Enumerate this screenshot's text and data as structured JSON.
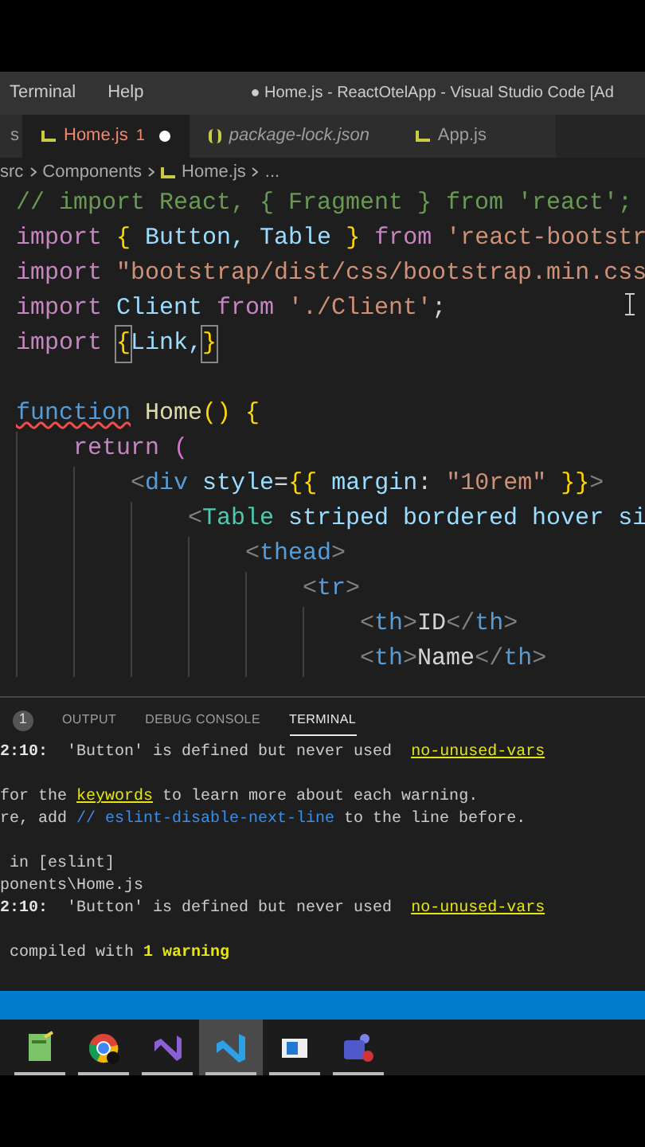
{
  "menu_bar": {
    "items": [
      "Terminal",
      "Help"
    ],
    "title": "● Home.js - ReactOtelApp - Visual Studio Code [Ad"
  },
  "tabs": [
    {
      "label": "s",
      "kind": "cut",
      "selected": false
    },
    {
      "label": "Home.js",
      "kind": "js",
      "problems": "1",
      "modified": true,
      "selected": true
    },
    {
      "label": "package-lock.json",
      "kind": "json",
      "preview": true,
      "selected": false
    },
    {
      "label": "App.js",
      "kind": "js",
      "selected": false
    }
  ],
  "breadcrumb": [
    {
      "label": "src",
      "kind": "folder"
    },
    {
      "label": "Components",
      "kind": "folder"
    },
    {
      "label": "Home.js",
      "kind": "js"
    },
    {
      "label": "...",
      "kind": "symbol"
    }
  ],
  "code": {
    "lines": [
      [
        {
          "text": "// import React, { Fragment } from 'react';",
          "kind": "comment"
        }
      ],
      [
        {
          "text": "import",
          "kind": "keyword"
        },
        {
          "text": " {",
          "kind": "brace"
        },
        {
          "text": " Button, Table ",
          "kind": "variable"
        },
        {
          "text": "}",
          "kind": "brace"
        },
        {
          "text": " from",
          "kind": "keyword"
        },
        {
          "text": " 'react-bootstr",
          "kind": "string"
        }
      ],
      [
        {
          "text": "import",
          "kind": "keyword"
        },
        {
          "text": " \"bootstrap/dist/css/bootstrap.min.css",
          "kind": "string"
        }
      ],
      [
        {
          "text": "import",
          "kind": "keyword"
        },
        {
          "text": " Client",
          "kind": "variable"
        },
        {
          "text": " from",
          "kind": "keyword"
        },
        {
          "text": " './Client'",
          "kind": "string"
        },
        {
          "text": ";",
          "kind": "plain"
        }
      ],
      [
        {
          "text": "import ",
          "kind": "keyword"
        },
        {
          "text": "{",
          "kind": "matched-brace"
        },
        {
          "text": "Link,",
          "kind": "variable"
        },
        {
          "text": "}",
          "kind": "matched-brace"
        }
      ],
      [
        {
          "kind": "blank"
        }
      ],
      [
        {
          "text": "function",
          "kind": "error-keyword"
        },
        {
          "text": " Home",
          "kind": "function"
        },
        {
          "text": "() {",
          "kind": "brace"
        }
      ],
      [
        {
          "text": "    return",
          "kind": "keyword"
        },
        {
          "text": " (",
          "kind": "paren"
        }
      ],
      [
        {
          "text": "        <",
          "kind": "punct"
        },
        {
          "text": "div",
          "kind": "tag"
        },
        {
          "text": " style",
          "kind": "variable"
        },
        {
          "text": "=",
          "kind": "plain"
        },
        {
          "text": "{{",
          "kind": "brace"
        },
        {
          "text": " margin",
          "kind": "variable"
        },
        {
          "text": ": ",
          "kind": "plain"
        },
        {
          "text": "\"10rem\"",
          "kind": "string"
        },
        {
          "text": " }}",
          "kind": "brace"
        },
        {
          "text": ">",
          "kind": "punct"
        }
      ],
      [
        {
          "text": "            <",
          "kind": "punct"
        },
        {
          "text": "Table",
          "kind": "component"
        },
        {
          "text": " striped bordered hover si",
          "kind": "variable"
        }
      ],
      [
        {
          "text": "                <",
          "kind": "punct"
        },
        {
          "text": "thead",
          "kind": "tag"
        },
        {
          "text": ">",
          "kind": "punct"
        }
      ],
      [
        {
          "text": "                    <",
          "kind": "punct"
        },
        {
          "text": "tr",
          "kind": "tag"
        },
        {
          "text": ">",
          "kind": "punct"
        }
      ],
      [
        {
          "text": "                        <",
          "kind": "punct"
        },
        {
          "text": "th",
          "kind": "tag"
        },
        {
          "text": ">",
          "kind": "punct"
        },
        {
          "text": "ID",
          "kind": "plain"
        },
        {
          "text": "</",
          "kind": "punct"
        },
        {
          "text": "th",
          "kind": "tag"
        },
        {
          "text": ">",
          "kind": "punct"
        }
      ],
      [
        {
          "text": "                        <",
          "kind": "punct"
        },
        {
          "text": "th",
          "kind": "tag"
        },
        {
          "text": ">",
          "kind": "punct"
        },
        {
          "text": "Name",
          "kind": "plain"
        },
        {
          "text": "</",
          "kind": "punct"
        },
        {
          "text": "th",
          "kind": "tag"
        },
        {
          "text": ">",
          "kind": "punct"
        }
      ]
    ]
  },
  "panel": {
    "problems_badge": "1",
    "tabs": [
      {
        "label": "OUTPUT",
        "selected": false
      },
      {
        "label": "DEBUG CONSOLE",
        "selected": false
      },
      {
        "label": "TERMINAL",
        "selected": true
      }
    ],
    "terminal_lines": [
      [
        {
          "text": "2:10:",
          "kind": "bold"
        },
        {
          "text": "  'Button' is defined but never used  ",
          "kind": "plain"
        },
        {
          "text": "no-unused-vars",
          "kind": "link"
        }
      ],
      [
        {
          "kind": "blank"
        }
      ],
      [
        {
          "text": "for the ",
          "kind": "plain"
        },
        {
          "text": "keywords",
          "kind": "link"
        },
        {
          "text": " to learn more about each warning.",
          "kind": "plain"
        }
      ],
      [
        {
          "text": "re, add ",
          "kind": "plain"
        },
        {
          "text": "// eslint-disable-next-line",
          "kind": "comment"
        },
        {
          "text": " to the line before.",
          "kind": "plain"
        }
      ],
      [
        {
          "kind": "blank"
        }
      ],
      [
        {
          "text": " in [eslint]",
          "kind": "plain"
        }
      ],
      [
        {
          "text": "ponents\\Home.js",
          "kind": "plain"
        }
      ],
      [
        {
          "text": "2:10:",
          "kind": "bold"
        },
        {
          "text": "  'Button' is defined but never used  ",
          "kind": "plain"
        },
        {
          "text": "no-unused-vars",
          "kind": "link"
        }
      ],
      [
        {
          "kind": "blank"
        }
      ],
      [
        {
          "text": " compiled with ",
          "kind": "plain"
        },
        {
          "text": "1 warning",
          "kind": "warning"
        }
      ]
    ]
  },
  "taskbar": [
    {
      "kind": "spreadsheet",
      "selected": false
    },
    {
      "kind": "browser",
      "selected": false
    },
    {
      "kind": "ide",
      "selected": false
    },
    {
      "kind": "editor",
      "selected": true
    },
    {
      "kind": "window",
      "selected": false
    },
    {
      "kind": "chat",
      "selected": false
    }
  ]
}
